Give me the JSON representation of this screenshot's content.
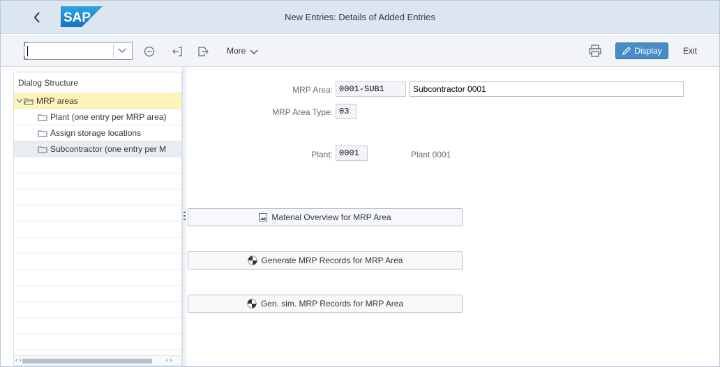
{
  "window": {
    "title": "New Entries: Details of Added Entries",
    "logo_text": "SAP"
  },
  "toolbar": {
    "command_field_value": "",
    "more_label": "More",
    "display_label": "Display",
    "exit_label": "Exit"
  },
  "dialog_structure": {
    "header": "Dialog Structure",
    "items": [
      {
        "label": "MRP areas"
      },
      {
        "label": "Plant (one entry per MRP area)"
      },
      {
        "label": "Assign storage locations"
      },
      {
        "label": "Subcontractor (one entry per M"
      }
    ]
  },
  "form": {
    "mrp_area_label": "MRP Area:",
    "mrp_area_value": "0001-SUB1",
    "mrp_area_desc": "Subcontractor 0001",
    "mrp_area_type_label": "MRP Area Type:",
    "mrp_area_type_value": "03",
    "plant_label": "Plant:",
    "plant_value": "0001",
    "plant_desc": "Plant 0001"
  },
  "actions": {
    "material_overview": "Material Overview for MRP Area",
    "generate_records": "Generate MRP Records for MRP Area",
    "gen_sim_records": "Gen. sim. MRP Records for MRP Area"
  },
  "colors": {
    "accent": "#4a8cc7",
    "title_bar": "#dbe6f1",
    "selection": "#fff4b8"
  }
}
